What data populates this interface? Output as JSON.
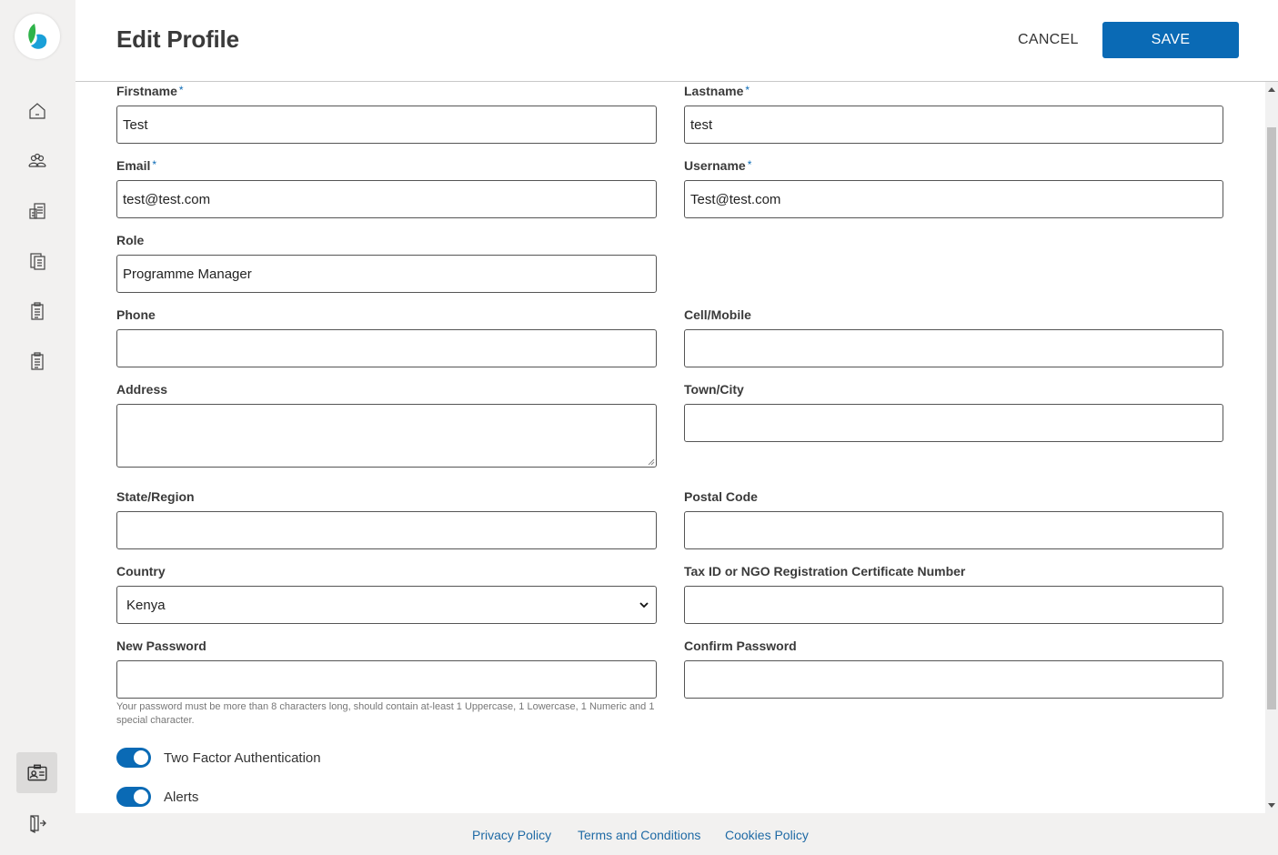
{
  "header": {
    "title": "Edit Profile",
    "cancel_label": "CANCEL",
    "save_label": "SAVE"
  },
  "form": {
    "firstname": {
      "label": "Firstname",
      "value": "Test",
      "required": "*"
    },
    "lastname": {
      "label": "Lastname",
      "value": "test",
      "required": "*"
    },
    "email": {
      "label": "Email",
      "value": "test@test.com",
      "required": "*"
    },
    "username": {
      "label": "Username",
      "value": "Test@test.com",
      "required": "*"
    },
    "role": {
      "label": "Role",
      "value": "Programme Manager"
    },
    "phone": {
      "label": "Phone",
      "value": ""
    },
    "mobile": {
      "label": "Cell/Mobile",
      "value": ""
    },
    "address": {
      "label": "Address",
      "value": ""
    },
    "city": {
      "label": "Town/City",
      "value": ""
    },
    "state": {
      "label": "State/Region",
      "value": ""
    },
    "postal": {
      "label": "Postal Code",
      "value": ""
    },
    "country": {
      "label": "Country",
      "value": "Kenya"
    },
    "taxid": {
      "label": "Tax ID or NGO Registration Certificate Number",
      "value": ""
    },
    "new_password": {
      "label": "New Password",
      "value": ""
    },
    "confirm_password": {
      "label": "Confirm Password",
      "value": ""
    },
    "password_hint": "Your password must be more than 8 characters long, should contain at-least 1 Uppercase, 1 Lowercase, 1 Numeric and 1 special character.",
    "two_factor": {
      "label": "Two Factor Authentication",
      "enabled": true
    },
    "alerts": {
      "label": "Alerts",
      "enabled": true
    }
  },
  "footer": {
    "privacy": "Privacy Policy",
    "terms": "Terms and Conditions",
    "cookies": "Cookies Policy"
  },
  "colors": {
    "accent": "#0a6ab5",
    "link": "#1f6aa5",
    "sidebar": "#f2f1f0"
  },
  "sidebar": {
    "icons": [
      "home-icon",
      "users-icon",
      "document-list-icon",
      "documents-icon",
      "clipboard-icon",
      "clipboard-icon",
      "profile-card-icon",
      "logout-icon"
    ]
  }
}
